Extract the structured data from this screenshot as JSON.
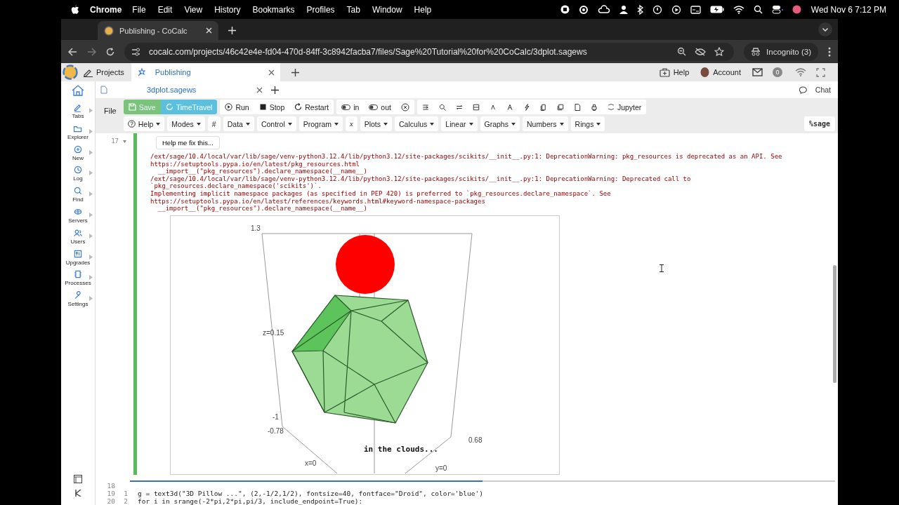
{
  "menubar": {
    "app": "Chrome",
    "menus": [
      "File",
      "Edit",
      "View",
      "History",
      "Bookmarks",
      "Profiles",
      "Tab",
      "Window",
      "Help"
    ],
    "clock": "Wed Nov 6  7:12 PM"
  },
  "browser": {
    "tab_title": "Publishing - CoCalc",
    "url": "cocalc.com/projects/46c42e4e-fd04-470d-84ff-3c8942facba7/files/Sage%20Tutorial%20for%20CoCalc/3dplot.sagews",
    "incognito": "Incognito (3)"
  },
  "cocalc": {
    "projects": "Projects",
    "tabs": [
      {
        "label": "Publishing",
        "selected": true
      }
    ],
    "help": "Help",
    "account": "Account",
    "notifications": "0"
  },
  "sidebar": [
    {
      "label": "Tabs"
    },
    {
      "label": "Explorer"
    },
    {
      "label": "New"
    },
    {
      "label": "Log"
    },
    {
      "label": "Find"
    },
    {
      "label": "Servers"
    },
    {
      "label": "Users"
    },
    {
      "label": "Upgrades"
    },
    {
      "label": "Processes"
    },
    {
      "label": "Settings"
    }
  ],
  "file_tab": {
    "label": "3dplot.sagews",
    "selected": true
  },
  "chat": "Chat",
  "toolbar": {
    "file": "File",
    "buttons": [
      {
        "label": "Save",
        "kind": "save"
      },
      {
        "label": "TimeTravel",
        "kind": "timetravel"
      },
      {
        "label": "Run",
        "kind": "run"
      },
      {
        "label": "Stop",
        "kind": "stop"
      },
      {
        "label": "Restart",
        "kind": "restart"
      },
      {
        "label": "in",
        "kind": "toggle"
      },
      {
        "label": "out",
        "kind": "toggle"
      }
    ],
    "jupyter": "Jupyter"
  },
  "menus": [
    {
      "label": "Help",
      "dropdown": true
    },
    {
      "label": "Modes",
      "dropdown": true
    },
    {
      "label": "#",
      "dropdown": false
    },
    {
      "label": "Data",
      "dropdown": true
    },
    {
      "label": "Control",
      "dropdown": true
    },
    {
      "label": "Program",
      "dropdown": true
    },
    {
      "label": "x",
      "dropdown": false
    },
    {
      "label": "Plots",
      "dropdown": true
    },
    {
      "label": "Calculus",
      "dropdown": true
    },
    {
      "label": "Linear",
      "dropdown": true
    },
    {
      "label": "Graphs",
      "dropdown": true
    },
    {
      "label": "Numbers",
      "dropdown": true
    },
    {
      "label": "Rings",
      "dropdown": true
    }
  ],
  "mode": "%sage",
  "cell": {
    "number": "17",
    "help_button": "Help me fix this...",
    "output": [
      "/ext/sage/10.4/local/var/lib/sage/venv-python3.12.4/lib/python3.12/site-packages/scikits/__init__.py:1: DeprecationWarning: pkg_resources is deprecated as an API. See",
      "https://setuptools.pypa.io/en/latest/pkg_resources.html",
      "  __import__(\"pkg_resources\").declare_namespace(__name__)",
      "/ext/sage/10.4/local/var/lib/sage/venv-python3.12.4/lib/python3.12/site-packages/scikits/__init__.py:1: DeprecationWarning: Deprecated call to",
      "`pkg_resources.declare_namespace('scikits')`.",
      "Implementing implicit namespace packages (as specified in PEP 420) is preferred to `pkg_resources.declare_namespace`. See",
      "https://setuptools.pypa.io/en/latest/references/keywords.html#keyword-namespace-packages",
      "  __import__(\"pkg_resources\").declare_namespace(__name__)"
    ],
    "plot_labels": [
      "1.3",
      "z=0.15",
      "-1",
      "-0.78",
      "0.68",
      "in the clouds...",
      "x=0",
      "y=0"
    ]
  },
  "code": [
    {
      "cell": "18"
    },
    {
      "cell": "19",
      "line": "1",
      "text": "g = text3d(\"3D Pillow ...\", (2,-1/2,1/2), fontsize=40, fontface=\"Droid\", color='blue')"
    },
    {
      "cell": "20",
      "line": "2",
      "text": "for i in srange(-2*pi,2*pi,pi/3, include_endpoint=True):"
    }
  ]
}
